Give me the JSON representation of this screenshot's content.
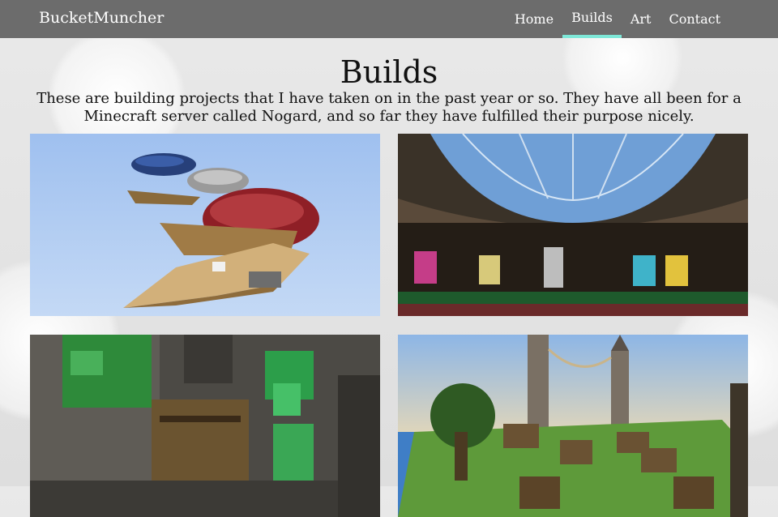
{
  "navbar": {
    "brand": "BucketMuncher",
    "items": [
      {
        "label": "Home",
        "active": false
      },
      {
        "label": "Builds",
        "active": true
      },
      {
        "label": "Art",
        "active": false
      },
      {
        "label": "Contact",
        "active": false
      }
    ],
    "accent_color": "#7ee8d8"
  },
  "main": {
    "title": "Builds",
    "intro": "These are building projects that I have taken on in the past year or so. They have all been for a Minecraft server called Nogard, and so far they have fulfilled their purpose nicely."
  },
  "gallery": {
    "items": [
      {
        "icon": "airship-image"
      },
      {
        "icon": "glass-dome-hall-image"
      },
      {
        "icon": "emerald-cave-image"
      },
      {
        "icon": "tower-village-image"
      }
    ]
  }
}
